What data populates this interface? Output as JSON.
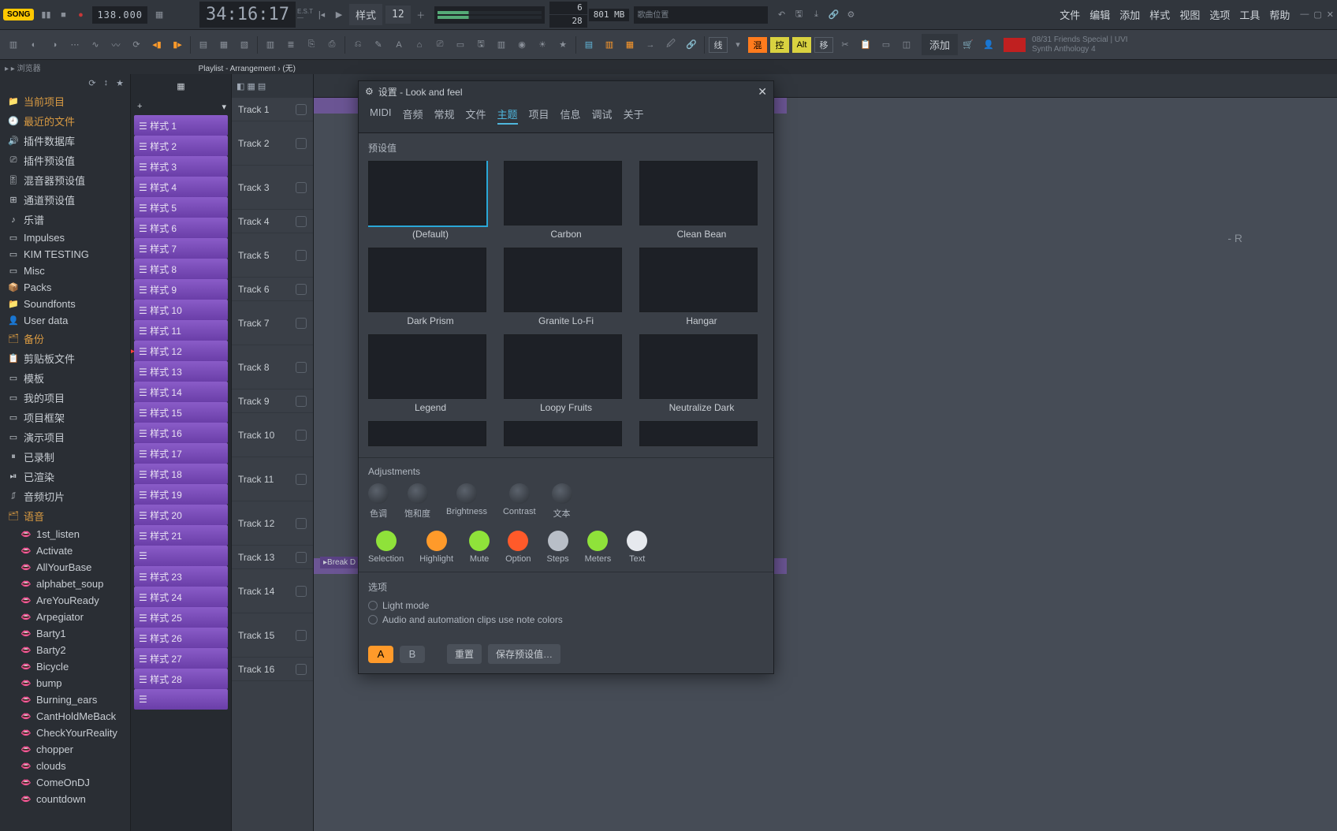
{
  "topbar": {
    "song_badge": "SONG",
    "tempo": "138.000",
    "time": "34:16:17",
    "time_suffix": "E.S.T\n—",
    "pattern_label": "样式",
    "pattern_num": "12",
    "num_a": "6",
    "num_b": "801 MB",
    "num_c": "28",
    "songpos_label": "歌曲位置",
    "menus": [
      "文件",
      "编辑",
      "添加",
      "样式",
      "视图",
      "选项",
      "工具",
      "帮助"
    ]
  },
  "toolbar2": {
    "boxes_line": "线",
    "boxes": [
      "混",
      "控",
      "Alt",
      "移"
    ],
    "add_label": "添加",
    "news_line1": "08/31  Friends Special | UVI",
    "news_line2": "Synth Anthology 4"
  },
  "row3": {
    "crumbs": "▸ ▸   浏览器",
    "ptitle": "Playlist - Arrangement › (无)"
  },
  "browser": {
    "items": [
      {
        "ico": "📁",
        "label": "当前项目",
        "cls": "accent",
        "name": "current-project"
      },
      {
        "ico": "🕘",
        "label": "最近的文件",
        "cls": "accent",
        "name": "recent-files"
      },
      {
        "ico": "🔊",
        "label": "插件数据库",
        "cls": "",
        "name": "plugin-db"
      },
      {
        "ico": "⎚",
        "label": "插件预设值",
        "cls": "",
        "name": "plugin-presets"
      },
      {
        "ico": "🎚",
        "label": "混音器预设值",
        "cls": "",
        "name": "mixer-presets"
      },
      {
        "ico": "⊞",
        "label": "通道预设值",
        "cls": "",
        "name": "channel-presets"
      },
      {
        "ico": "♪",
        "label": "乐谱",
        "cls": "",
        "name": "scores"
      },
      {
        "ico": "▭",
        "label": "Impulses",
        "cls": "",
        "name": "impulses"
      },
      {
        "ico": "▭",
        "label": "KIM TESTING",
        "cls": "",
        "name": "kim-testing"
      },
      {
        "ico": "▭",
        "label": "Misc",
        "cls": "",
        "name": "misc"
      },
      {
        "ico": "📦",
        "label": "Packs",
        "cls": "",
        "name": "packs"
      },
      {
        "ico": "📁",
        "label": "Soundfonts",
        "cls": "",
        "name": "soundfonts"
      },
      {
        "ico": "👤",
        "label": "User data",
        "cls": "",
        "name": "user-data"
      },
      {
        "ico": "🗂",
        "label": "备份",
        "cls": "accent",
        "name": "backup"
      },
      {
        "ico": "📋",
        "label": "剪贴板文件",
        "cls": "",
        "name": "clipboard-files"
      },
      {
        "ico": "▭",
        "label": "模板",
        "cls": "",
        "name": "templates"
      },
      {
        "ico": "▭",
        "label": "我的项目",
        "cls": "",
        "name": "my-projects"
      },
      {
        "ico": "▭",
        "label": "项目框架",
        "cls": "",
        "name": "project-bones"
      },
      {
        "ico": "▭",
        "label": "演示项目",
        "cls": "",
        "name": "demo-projects"
      },
      {
        "ico": "⏸",
        "label": "已录制",
        "cls": "",
        "name": "recorded"
      },
      {
        "ico": "⏯",
        "label": "已渲染",
        "cls": "",
        "name": "rendered"
      },
      {
        "ico": "⎎",
        "label": "音频切片",
        "cls": "",
        "name": "sliced-audio"
      },
      {
        "ico": "🗂",
        "label": "语音",
        "cls": "accent",
        "name": "speech"
      }
    ],
    "speech_children": [
      "1st_listen",
      "Activate",
      "AllYourBase",
      "alphabet_soup",
      "AreYouReady",
      "Arpegiator",
      "Barty1",
      "Barty2",
      "Bicycle",
      "bump",
      "Burning_ears",
      "CantHoldMeBack",
      "CheckYourReality",
      "chopper",
      "clouds",
      "ComeOnDJ",
      "countdown"
    ]
  },
  "picker": {
    "plus": "+",
    "patterns": [
      "样式 1",
      "样式 2",
      "样式 3",
      "样式 4",
      "样式 5",
      "样式 6",
      "样式 7",
      "样式 8",
      "样式 9",
      "样式 10",
      "样式 11",
      "样式 12",
      "样式 13",
      "样式 14",
      "样式 15",
      "样式 16",
      "样式 17",
      "样式 18",
      "样式 19",
      "样式 20",
      "样式 21",
      " ",
      "样式 23",
      "样式 24",
      "样式 25",
      "样式 26",
      "样式 27",
      "样式 28",
      " "
    ],
    "pinned_index": 11
  },
  "tracks": {
    "header_icons": "◧ ▦ ▤",
    "list": [
      "Track 1",
      "Track 2",
      "Track 3",
      "Track 4",
      "Track 5",
      "Track 6",
      "Track 7",
      "Track 8",
      "Track 9",
      "Track 10",
      "Track 11",
      "Track 12",
      "Track 13",
      "Track 14",
      "Track 15",
      "Track 16"
    ]
  },
  "arrangement": {
    "break_clip": "▸Break D"
  },
  "modal": {
    "title": "设置 - Look and feel",
    "tabs": [
      "MIDI",
      "音频",
      "常规",
      "文件",
      "主题",
      "项目",
      "信息",
      "调试",
      "关于"
    ],
    "active_tab": 4,
    "presets_label": "预设值",
    "themes": [
      "(Default)",
      "Carbon",
      "Clean Bean",
      "Dark Prism",
      "Granite Lo-Fi",
      "Hangar",
      "Legend",
      "Loopy Fruits",
      "Neutralize Dark"
    ],
    "themes_partial": [
      "",
      "",
      ""
    ],
    "adjustments_label": "Adjustments",
    "knobs": [
      "色调",
      "饱和度",
      "Brightness",
      "Contrast",
      "文本"
    ],
    "swatches": [
      {
        "label": "Selection",
        "color": "#8fe23a"
      },
      {
        "label": "Highlight",
        "color": "#ff9a2a"
      },
      {
        "label": "Mute",
        "color": "#8fe23a"
      },
      {
        "label": "Option",
        "color": "#ff5a2a"
      },
      {
        "label": "Steps",
        "color": "#b8bec7"
      },
      {
        "label": "Meters",
        "color": "#8fe23a"
      },
      {
        "label": "Text",
        "color": "#e6e9ee"
      }
    ],
    "options_label": "选项",
    "options": [
      "Light mode",
      "Audio and automation clips use note colors"
    ],
    "ab_a": "A",
    "ab_b": "B",
    "btn_reset": "重置",
    "btn_save": "保存预设值…"
  },
  "hint_r": "- R"
}
